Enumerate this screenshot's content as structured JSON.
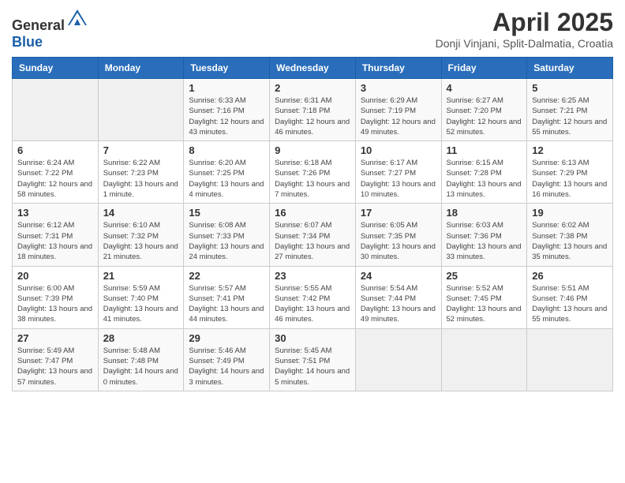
{
  "header": {
    "logo_general": "General",
    "logo_blue": "Blue",
    "month_title": "April 2025",
    "subtitle": "Donji Vinjani, Split-Dalmatia, Croatia"
  },
  "weekdays": [
    "Sunday",
    "Monday",
    "Tuesday",
    "Wednesday",
    "Thursday",
    "Friday",
    "Saturday"
  ],
  "weeks": [
    [
      {
        "day": "",
        "info": ""
      },
      {
        "day": "",
        "info": ""
      },
      {
        "day": "1",
        "info": "Sunrise: 6:33 AM\nSunset: 7:16 PM\nDaylight: 12 hours and 43 minutes."
      },
      {
        "day": "2",
        "info": "Sunrise: 6:31 AM\nSunset: 7:18 PM\nDaylight: 12 hours and 46 minutes."
      },
      {
        "day": "3",
        "info": "Sunrise: 6:29 AM\nSunset: 7:19 PM\nDaylight: 12 hours and 49 minutes."
      },
      {
        "day": "4",
        "info": "Sunrise: 6:27 AM\nSunset: 7:20 PM\nDaylight: 12 hours and 52 minutes."
      },
      {
        "day": "5",
        "info": "Sunrise: 6:25 AM\nSunset: 7:21 PM\nDaylight: 12 hours and 55 minutes."
      }
    ],
    [
      {
        "day": "6",
        "info": "Sunrise: 6:24 AM\nSunset: 7:22 PM\nDaylight: 12 hours and 58 minutes."
      },
      {
        "day": "7",
        "info": "Sunrise: 6:22 AM\nSunset: 7:23 PM\nDaylight: 13 hours and 1 minute."
      },
      {
        "day": "8",
        "info": "Sunrise: 6:20 AM\nSunset: 7:25 PM\nDaylight: 13 hours and 4 minutes."
      },
      {
        "day": "9",
        "info": "Sunrise: 6:18 AM\nSunset: 7:26 PM\nDaylight: 13 hours and 7 minutes."
      },
      {
        "day": "10",
        "info": "Sunrise: 6:17 AM\nSunset: 7:27 PM\nDaylight: 13 hours and 10 minutes."
      },
      {
        "day": "11",
        "info": "Sunrise: 6:15 AM\nSunset: 7:28 PM\nDaylight: 13 hours and 13 minutes."
      },
      {
        "day": "12",
        "info": "Sunrise: 6:13 AM\nSunset: 7:29 PM\nDaylight: 13 hours and 16 minutes."
      }
    ],
    [
      {
        "day": "13",
        "info": "Sunrise: 6:12 AM\nSunset: 7:31 PM\nDaylight: 13 hours and 18 minutes."
      },
      {
        "day": "14",
        "info": "Sunrise: 6:10 AM\nSunset: 7:32 PM\nDaylight: 13 hours and 21 minutes."
      },
      {
        "day": "15",
        "info": "Sunrise: 6:08 AM\nSunset: 7:33 PM\nDaylight: 13 hours and 24 minutes."
      },
      {
        "day": "16",
        "info": "Sunrise: 6:07 AM\nSunset: 7:34 PM\nDaylight: 13 hours and 27 minutes."
      },
      {
        "day": "17",
        "info": "Sunrise: 6:05 AM\nSunset: 7:35 PM\nDaylight: 13 hours and 30 minutes."
      },
      {
        "day": "18",
        "info": "Sunrise: 6:03 AM\nSunset: 7:36 PM\nDaylight: 13 hours and 33 minutes."
      },
      {
        "day": "19",
        "info": "Sunrise: 6:02 AM\nSunset: 7:38 PM\nDaylight: 13 hours and 35 minutes."
      }
    ],
    [
      {
        "day": "20",
        "info": "Sunrise: 6:00 AM\nSunset: 7:39 PM\nDaylight: 13 hours and 38 minutes."
      },
      {
        "day": "21",
        "info": "Sunrise: 5:59 AM\nSunset: 7:40 PM\nDaylight: 13 hours and 41 minutes."
      },
      {
        "day": "22",
        "info": "Sunrise: 5:57 AM\nSunset: 7:41 PM\nDaylight: 13 hours and 44 minutes."
      },
      {
        "day": "23",
        "info": "Sunrise: 5:55 AM\nSunset: 7:42 PM\nDaylight: 13 hours and 46 minutes."
      },
      {
        "day": "24",
        "info": "Sunrise: 5:54 AM\nSunset: 7:44 PM\nDaylight: 13 hours and 49 minutes."
      },
      {
        "day": "25",
        "info": "Sunrise: 5:52 AM\nSunset: 7:45 PM\nDaylight: 13 hours and 52 minutes."
      },
      {
        "day": "26",
        "info": "Sunrise: 5:51 AM\nSunset: 7:46 PM\nDaylight: 13 hours and 55 minutes."
      }
    ],
    [
      {
        "day": "27",
        "info": "Sunrise: 5:49 AM\nSunset: 7:47 PM\nDaylight: 13 hours and 57 minutes."
      },
      {
        "day": "28",
        "info": "Sunrise: 5:48 AM\nSunset: 7:48 PM\nDaylight: 14 hours and 0 minutes."
      },
      {
        "day": "29",
        "info": "Sunrise: 5:46 AM\nSunset: 7:49 PM\nDaylight: 14 hours and 3 minutes."
      },
      {
        "day": "30",
        "info": "Sunrise: 5:45 AM\nSunset: 7:51 PM\nDaylight: 14 hours and 5 minutes."
      },
      {
        "day": "",
        "info": ""
      },
      {
        "day": "",
        "info": ""
      },
      {
        "day": "",
        "info": ""
      }
    ]
  ]
}
